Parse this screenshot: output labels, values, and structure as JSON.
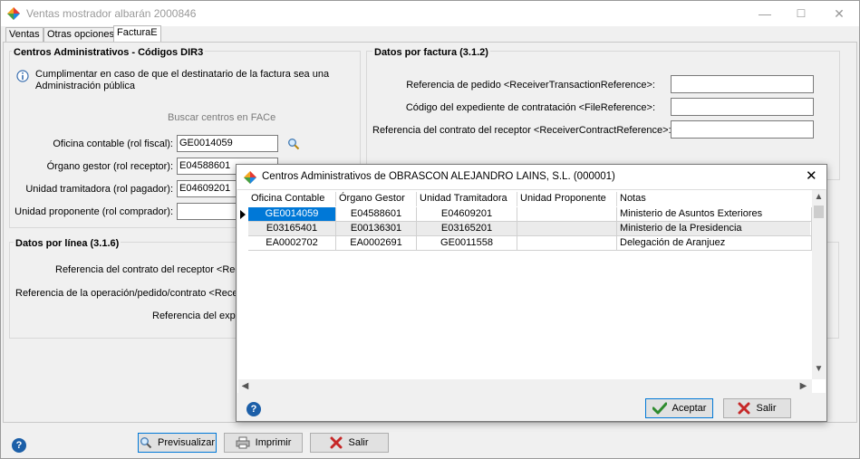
{
  "window": {
    "title": "Ventas mostrador albarán 2000846",
    "minimize": "—",
    "maximize": "☐",
    "close": "✕"
  },
  "tabs": [
    {
      "label": "Ventas"
    },
    {
      "label": "Otras opciones"
    },
    {
      "label": "FacturaE"
    }
  ],
  "dir3": {
    "title": "Centros Administrativos - Códigos DIR3",
    "info_text_1": "Cumplimentar en caso de que el destinatario de la factura sea una",
    "info_text_2": "Administración pública",
    "search_link": "Buscar centros en FACe",
    "oficina_label": "Oficina contable (rol fiscal):",
    "oficina_value": "GE0014059",
    "organo_label": "Órgano gestor (rol receptor):",
    "organo_value": "E04588601",
    "unidad_trami_label": "Unidad tramitadora (rol pagador):",
    "unidad_trami_value": "E04609201",
    "unidad_prop_label": "Unidad proponente (rol comprador):",
    "unidad_prop_value": ""
  },
  "por_factura": {
    "title": "Datos por factura (3.1.2)",
    "ref_pedido_label": "Referencia de pedido <ReceiverTransactionReference>:",
    "ref_pedido_value": "",
    "cod_exp_label": "Código del expediente de contratación <FileReference>:",
    "cod_exp_value": "",
    "ref_contrato_label": "Referencia del contrato del receptor <ReceiverContractReference>:",
    "ref_contrato_value": ""
  },
  "por_linea": {
    "title": "Datos por línea (3.1.6)",
    "ref_contrato_label": "Referencia del contrato del receptor <Receiv",
    "ref_operacion_label": "Referencia de la operación/pedido/contrato <ReceiverT",
    "ref_exped_label": "Referencia del exped"
  },
  "toolbar": {
    "preview_label": "Previsualizar",
    "print_label": "Imprimir",
    "exit_label": "Salir",
    "help": "?"
  },
  "dialog": {
    "title": "Centros Administrativos de  OBRASCON ALEJANDRO LAINS, S.L. (000001)",
    "close": "✕",
    "columns": [
      "Oficina Contable",
      "Órgano Gestor",
      "Unidad Tramitadora",
      "Unidad Proponente",
      "Notas"
    ],
    "rows": [
      [
        "GE0014059",
        "E04588601",
        "E04609201",
        "",
        "Ministerio de Asuntos Exteriores"
      ],
      [
        "E03165401",
        "E00136301",
        "E03165201",
        "",
        "Ministerio de la Presidencia"
      ],
      [
        "EA0002702",
        "EA0002691",
        "GE0011558",
        "",
        "Delegación de Aranjuez"
      ]
    ],
    "accept_label": "Aceptar",
    "exit_label": "Salir",
    "help": "?"
  }
}
